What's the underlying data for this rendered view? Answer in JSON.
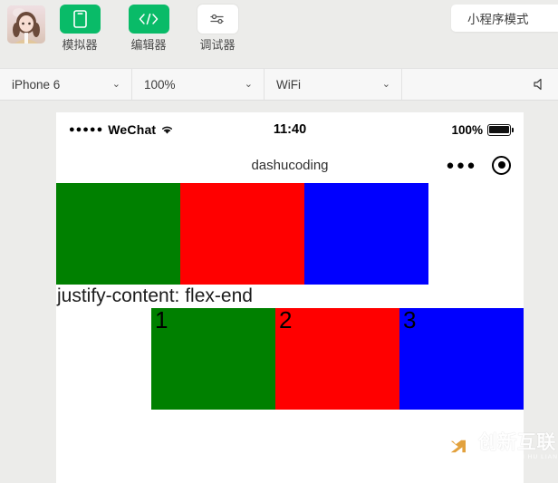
{
  "toolbar": {
    "avatar_name": "user-avatar",
    "items": [
      {
        "label": "模拟器",
        "icon": "phone-outline-icon",
        "state": "active"
      },
      {
        "label": "编辑器",
        "icon": "code-brackets-icon",
        "state": "active"
      },
      {
        "label": "调试器",
        "icon": "sliders-icon",
        "state": "inactive"
      }
    ],
    "mode_button": "小程序模式"
  },
  "selectbar": {
    "device": {
      "value": "iPhone 6",
      "chevron": "⌄"
    },
    "zoom": {
      "value": "100%",
      "chevron": "⌄"
    },
    "network": {
      "value": "WiFi",
      "chevron": "⌄"
    },
    "speaker_icon": "speaker-icon"
  },
  "simulator": {
    "statusbar": {
      "signal_dots": "●●●●●",
      "carrier": "WeChat",
      "wifi_icon": "wifi-icon",
      "time": "11:40",
      "battery_percent": "100%",
      "battery_icon": "battery-full-icon"
    },
    "navbar": {
      "title": "dashucoding",
      "more_icon": "more-dots-icon",
      "capsule_icon": "target-circle-icon"
    },
    "rows": [
      {
        "name": "row-flex-start",
        "justify": "flex-start",
        "boxes": [
          {
            "label": "",
            "color": "#008000"
          },
          {
            "label": "",
            "color": "#ff0000"
          },
          {
            "label": "",
            "color": "#0000ff"
          }
        ]
      },
      {
        "name": "row-flex-end",
        "justify": "flex-end",
        "boxes": [
          {
            "label": "1",
            "color": "#008000"
          },
          {
            "label": "2",
            "color": "#ff0000"
          },
          {
            "label": "3",
            "color": "#0000ff"
          }
        ]
      }
    ],
    "caption": "justify-content: flex-end"
  },
  "watermark": {
    "main": "创新互联",
    "sub": "CHUANG XIN HU LIAN",
    "logo_icon": "cx-logo-icon"
  },
  "colors": {
    "brand_green": "#09bb68",
    "green_box": "#008000",
    "red_box": "#ff0000",
    "blue_box": "#0000ff",
    "toolbar_bg": "#ececea",
    "selectbar_bg": "#f7f7f7"
  }
}
